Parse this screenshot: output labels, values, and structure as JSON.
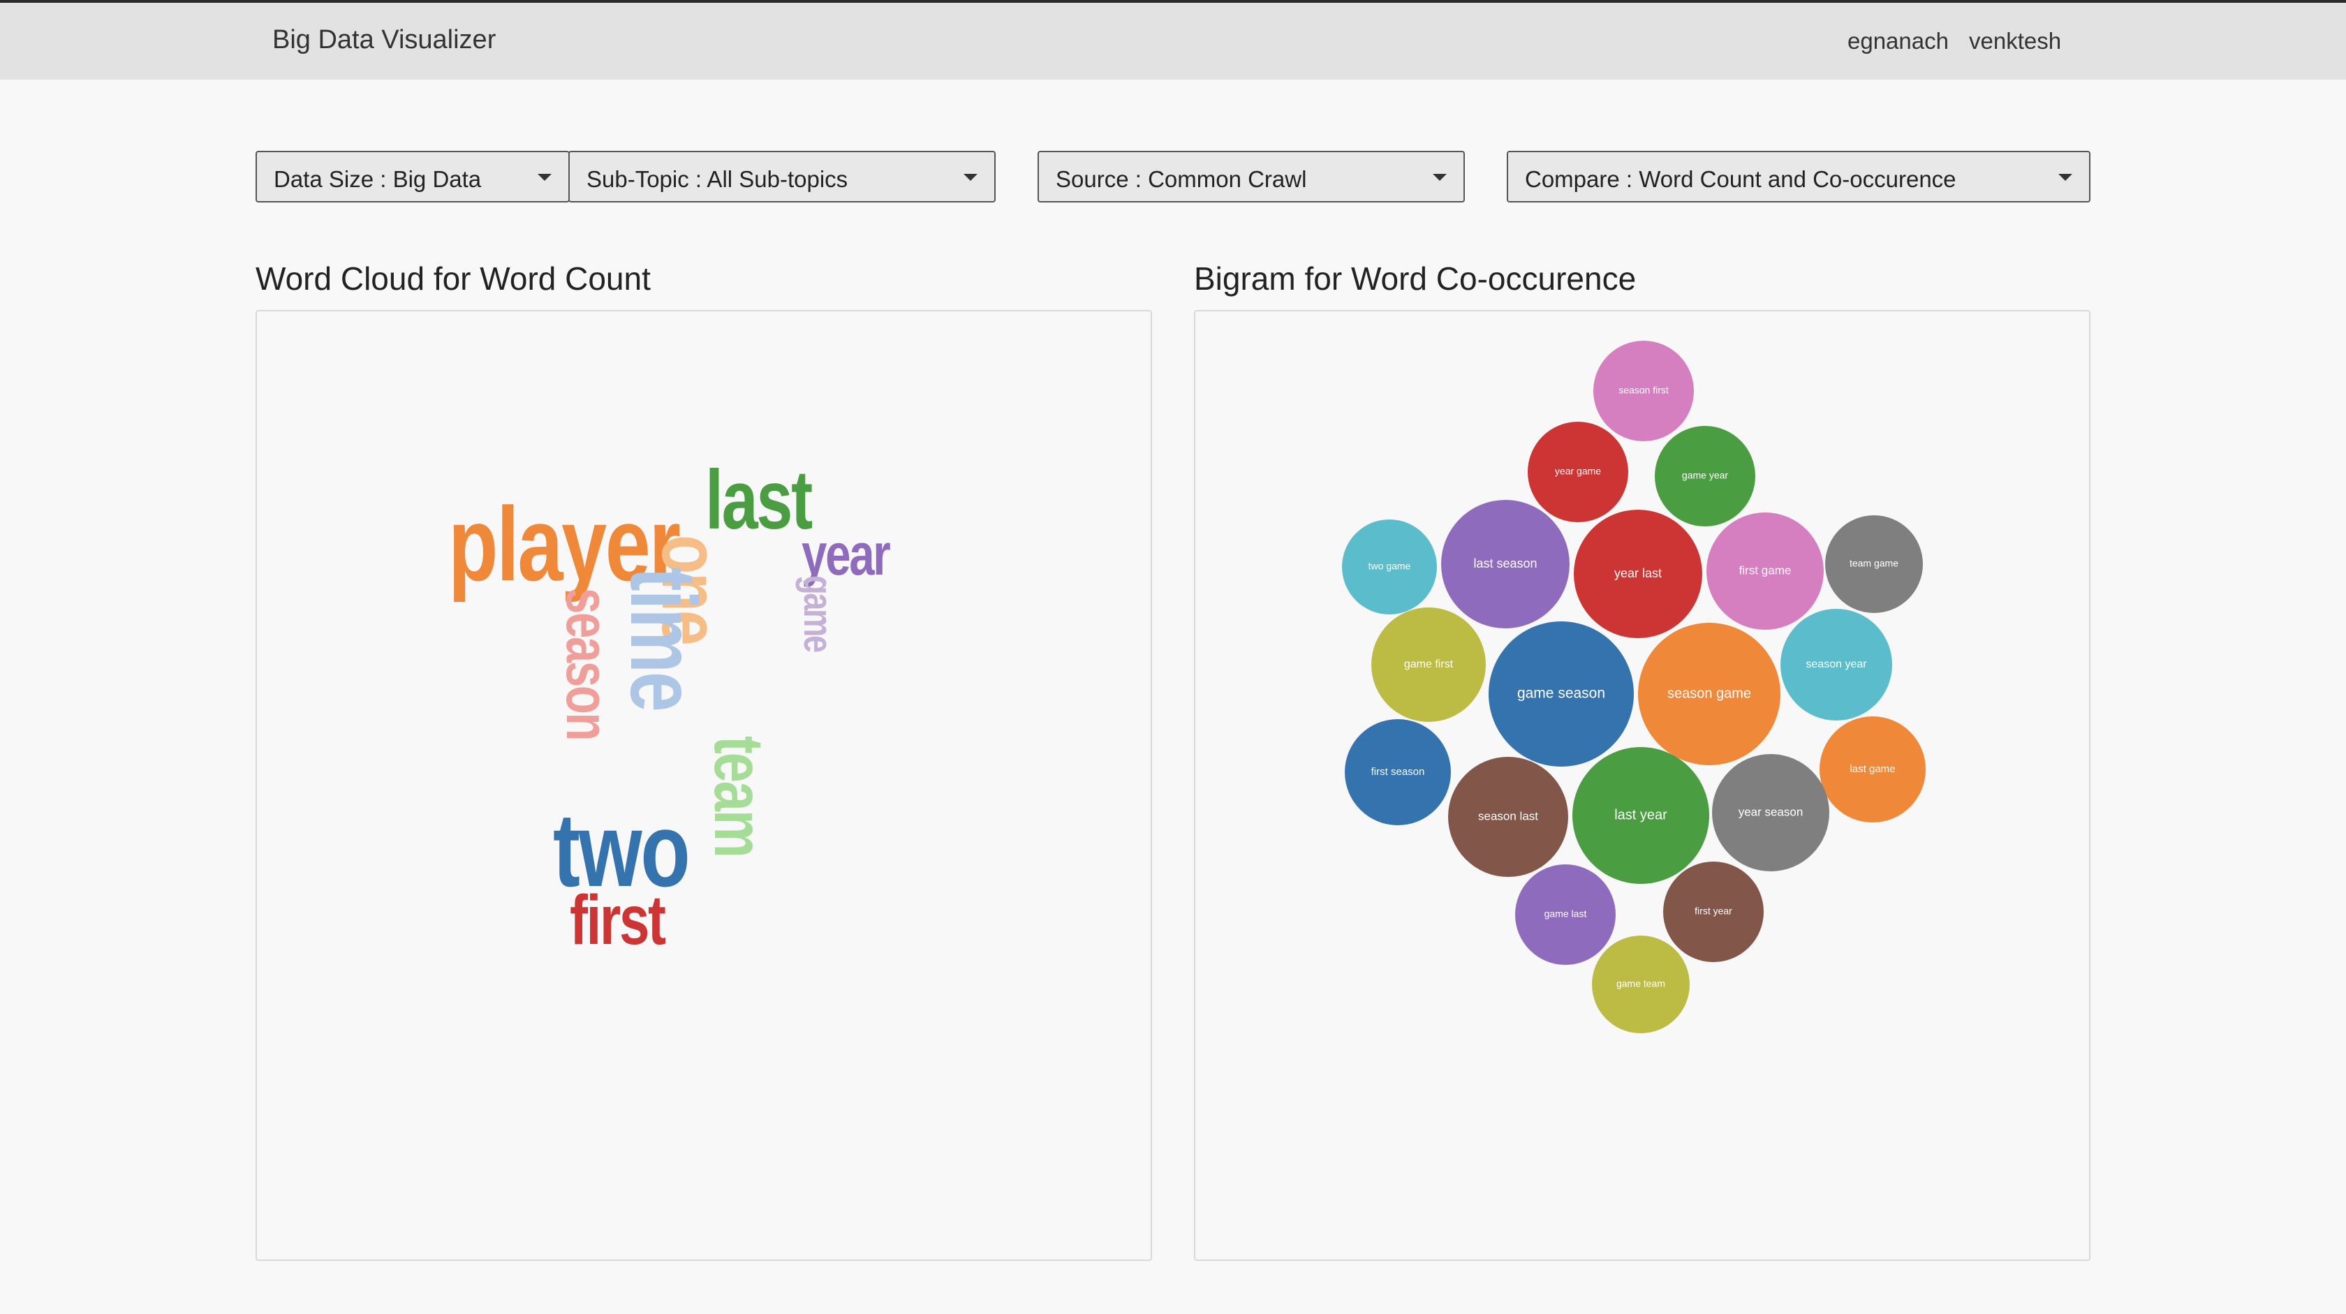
{
  "header": {
    "title": "Big Data Visualizer",
    "users": [
      "egnanach",
      "venktesh"
    ]
  },
  "filters": {
    "data_size": "Data Size : Big Data",
    "sub_topic": "Sub-Topic : All Sub-topics",
    "source": "Source : Common Crawl",
    "compare": "Compare : Word Count and Co-occurence"
  },
  "left_panel": {
    "title": "Word Cloud for Word Count",
    "words": [
      {
        "text": "player",
        "color": "#f0883a"
      },
      {
        "text": "last",
        "color": "#4a9e41"
      },
      {
        "text": "year",
        "color": "#8f6bbd"
      },
      {
        "text": "one",
        "color": "#f6be86"
      },
      {
        "text": "game",
        "color": "#c5b1d6"
      },
      {
        "text": "time",
        "color": "#adc6e6"
      },
      {
        "text": "season",
        "color": "#ef9e9a"
      },
      {
        "text": "team",
        "color": "#a5dc96"
      },
      {
        "text": "two",
        "color": "#3473ae"
      },
      {
        "text": "first",
        "color": "#cc3534"
      }
    ]
  },
  "right_panel": {
    "title": "Bigram for Word Co-occurence",
    "bubbles": [
      {
        "label": "season first",
        "color": "#d67fc0"
      },
      {
        "label": "year game",
        "color": "#cc3534"
      },
      {
        "label": "game year",
        "color": "#4a9e41"
      },
      {
        "label": "two game",
        "color": "#5bbccc"
      },
      {
        "label": "last season",
        "color": "#8f6bbd"
      },
      {
        "label": "year last",
        "color": "#cc3534"
      },
      {
        "label": "first game",
        "color": "#d67fc0"
      },
      {
        "label": "team game",
        "color": "#7f7f7f"
      },
      {
        "label": "game first",
        "color": "#bcbc44"
      },
      {
        "label": "game season",
        "color": "#3473ae"
      },
      {
        "label": "season game",
        "color": "#f0883a"
      },
      {
        "label": "season year",
        "color": "#5bbccc"
      },
      {
        "label": "first season",
        "color": "#3473ae"
      },
      {
        "label": "last game",
        "color": "#f0883a"
      },
      {
        "label": "season last",
        "color": "#83564a"
      },
      {
        "label": "last year",
        "color": "#4a9e41"
      },
      {
        "label": "year season",
        "color": "#7f7f7f"
      },
      {
        "label": "game last",
        "color": "#8f6bbd"
      },
      {
        "label": "first year",
        "color": "#83564a"
      },
      {
        "label": "game team",
        "color": "#bcbc44"
      }
    ]
  }
}
